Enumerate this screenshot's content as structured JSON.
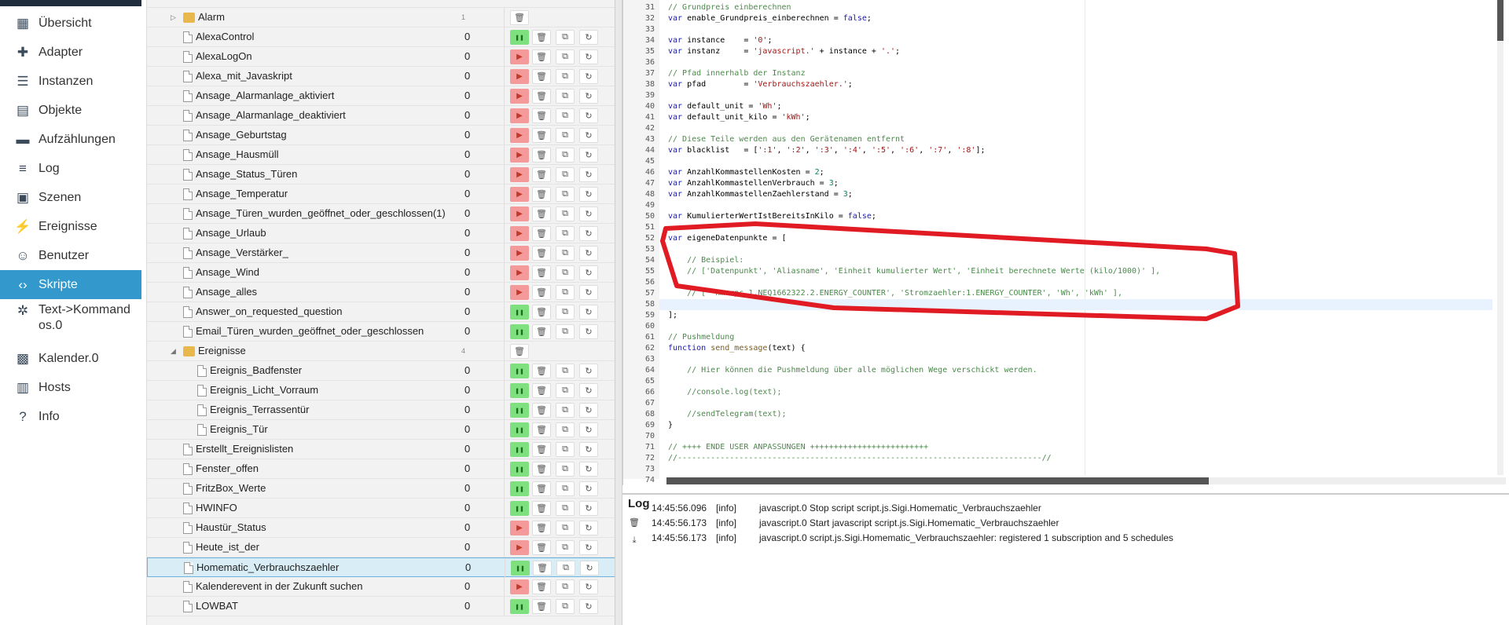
{
  "sidebar": {
    "items": [
      {
        "label": "Übersicht",
        "icon": "grid-icon"
      },
      {
        "label": "Adapter",
        "icon": "puzzle-icon"
      },
      {
        "label": "Instanzen",
        "icon": "list-icon"
      },
      {
        "label": "Objekte",
        "icon": "objects-icon"
      },
      {
        "label": "Aufzählungen",
        "icon": "enum-icon"
      },
      {
        "label": "Log",
        "icon": "log-icon"
      },
      {
        "label": "Szenen",
        "icon": "scenes-icon"
      },
      {
        "label": "Ereignisse",
        "icon": "lightning-icon"
      },
      {
        "label": "Benutzer",
        "icon": "user-icon"
      },
      {
        "label": "Skripte",
        "icon": "code-icon"
      },
      {
        "label": "Text->Kommandos.0",
        "icon": "asterisk-icon"
      },
      {
        "label": "Kalender.0",
        "icon": "calendar-icon"
      },
      {
        "label": "Hosts",
        "icon": "hosts-icon"
      },
      {
        "label": "Info",
        "icon": "info-icon"
      }
    ],
    "active": "Skripte"
  },
  "tree": {
    "folders": [
      {
        "name": "Alarm",
        "count": "1"
      },
      {
        "name": "Ereignisse",
        "count": "4"
      }
    ],
    "scripts": [
      {
        "name": "AlexaControl",
        "count": "0",
        "running": true
      },
      {
        "name": "AlexaLogOn",
        "count": "0",
        "running": false
      },
      {
        "name": "Alexa_mit_Javaskript",
        "count": "0",
        "running": false
      },
      {
        "name": "Ansage_Alarmanlage_aktiviert",
        "count": "0",
        "running": false
      },
      {
        "name": "Ansage_Alarmanlage_deaktiviert",
        "count": "0",
        "running": false
      },
      {
        "name": "Ansage_Geburtstag",
        "count": "0",
        "running": false
      },
      {
        "name": "Ansage_Hausmüll",
        "count": "0",
        "running": false
      },
      {
        "name": "Ansage_Status_Türen",
        "count": "0",
        "running": false
      },
      {
        "name": "Ansage_Temperatur",
        "count": "0",
        "running": false
      },
      {
        "name": "Ansage_Türen_wurden_geöffnet_oder_geschlossen(1)",
        "count": "0",
        "running": false
      },
      {
        "name": "Ansage_Urlaub",
        "count": "0",
        "running": false
      },
      {
        "name": "Ansage_Verstärker_",
        "count": "0",
        "running": false
      },
      {
        "name": "Ansage_Wind",
        "count": "0",
        "running": false
      },
      {
        "name": "Ansage_alles",
        "count": "0",
        "running": false
      },
      {
        "name": "Answer_on_requested_question",
        "count": "0",
        "running": true
      },
      {
        "name": "Email_Türen_wurden_geöffnet_oder_geschlossen",
        "count": "0",
        "running": true
      },
      {
        "name": "Ereignis_Badfenster",
        "count": "0",
        "running": true
      },
      {
        "name": "Ereignis_Licht_Vorraum",
        "count": "0",
        "running": true
      },
      {
        "name": "Ereignis_Terrassentür",
        "count": "0",
        "running": true
      },
      {
        "name": "Ereignis_Tür",
        "count": "0",
        "running": true
      },
      {
        "name": "Erstellt_Ereignislisten",
        "count": "0",
        "running": true
      },
      {
        "name": "Fenster_offen",
        "count": "0",
        "running": true
      },
      {
        "name": "FritzBox_Werte",
        "count": "0",
        "running": true
      },
      {
        "name": "HWINFO",
        "count": "0",
        "running": true
      },
      {
        "name": "Haustür_Status",
        "count": "0",
        "running": false
      },
      {
        "name": "Heute_ist_der",
        "count": "0",
        "running": false
      },
      {
        "name": "Homematic_Verbrauchszaehler",
        "count": "0",
        "running": true
      },
      {
        "name": "Kalenderevent in der Zukunft suchen",
        "count": "0",
        "running": false
      },
      {
        "name": "LOWBAT",
        "count": "0",
        "running": true
      }
    ]
  },
  "editor": {
    "lines": [
      {
        "n": "31",
        "text": "// Grundpreis einberechnen"
      },
      {
        "n": "32",
        "text": "var enable_Grundpreis_einberechnen = false;"
      },
      {
        "n": "33",
        "text": ""
      },
      {
        "n": "34",
        "text": "var instance    = '0';"
      },
      {
        "n": "35",
        "text": "var instanz     = 'javascript.' + instance + '.';"
      },
      {
        "n": "36",
        "text": ""
      },
      {
        "n": "37",
        "text": "// Pfad innerhalb der Instanz"
      },
      {
        "n": "38",
        "text": "var pfad        = 'Verbrauchszaehler.';"
      },
      {
        "n": "39",
        "text": ""
      },
      {
        "n": "40",
        "text": "var default_unit = 'Wh';"
      },
      {
        "n": "41",
        "text": "var default_unit_kilo = 'kWh';"
      },
      {
        "n": "42",
        "text": ""
      },
      {
        "n": "43",
        "text": "// Diese Teile werden aus den Gerätenamen entfernt"
      },
      {
        "n": "44",
        "text": "var blacklist   = [':1', ':2', ':3', ':4', ':5', ':6', ':7', ':8'];"
      },
      {
        "n": "45",
        "text": ""
      },
      {
        "n": "46",
        "text": "var AnzahlKommastellenKosten = 2;"
      },
      {
        "n": "47",
        "text": "var AnzahlKommastellenVerbrauch = 3;"
      },
      {
        "n": "48",
        "text": "var AnzahlKommastellenZaehlerstand = 3;"
      },
      {
        "n": "49",
        "text": ""
      },
      {
        "n": "50",
        "text": "var KumulierterWertIstBereitsInKilo = false;"
      },
      {
        "n": "51",
        "text": ""
      },
      {
        "n": "52",
        "text": "var eigeneDatenpunkte = ["
      },
      {
        "n": "53",
        "text": ""
      },
      {
        "n": "54",
        "text": "    // Beispiel:"
      },
      {
        "n": "55",
        "text": "    // ['Datenpunkt', 'Aliasname', 'Einheit kumulierter Wert', 'Einheit berechnete Werte (kilo/1000)' ],"
      },
      {
        "n": "56",
        "text": ""
      },
      {
        "n": "57",
        "text": "    // [ 'hm-rpc.1.NEQ1662322.2.ENERGY_COUNTER', 'Stromzaehler:1.ENERGY_COUNTER', 'Wh', 'kWh' ],"
      },
      {
        "n": "58",
        "text": "    "
      },
      {
        "n": "59",
        "text": "];"
      },
      {
        "n": "60",
        "text": ""
      },
      {
        "n": "61",
        "text": "// Pushmeldung"
      },
      {
        "n": "62",
        "text": "function send_message(text) {"
      },
      {
        "n": "63",
        "text": ""
      },
      {
        "n": "64",
        "text": "    // Hier können die Pushmeldung über alle möglichen Wege verschickt werden."
      },
      {
        "n": "65",
        "text": ""
      },
      {
        "n": "66",
        "text": "    //console.log(text);"
      },
      {
        "n": "67",
        "text": ""
      },
      {
        "n": "68",
        "text": "    //sendTelegram(text);"
      },
      {
        "n": "69",
        "text": "}"
      },
      {
        "n": "70",
        "text": ""
      },
      {
        "n": "71",
        "text": "// ++++ ENDE USER ANPASSUNGEN +++++++++++++++++++++++++"
      },
      {
        "n": "72",
        "text": "//-----------------------------------------------------------------------------//"
      },
      {
        "n": "73",
        "text": ""
      },
      {
        "n": "74",
        "text": ""
      }
    ]
  },
  "log": {
    "title": "Log",
    "entries": [
      {
        "time": "14:45:56.096",
        "level": "[info]",
        "msg": "javascript.0 Stop script script.js.Sigi.Homematic_Verbrauchszaehler"
      },
      {
        "time": "14:45:56.173",
        "level": "[info]",
        "msg": "javascript.0 Start javascript script.js.Sigi.Homematic_Verbrauchszaehler"
      },
      {
        "time": "14:45:56.173",
        "level": "[info]",
        "msg": "javascript.0 script.js.Sigi.Homematic_Verbrauchszaehler: registered 1 subscription and 5 schedules"
      }
    ]
  },
  "colors": {
    "accent": "#3399cc",
    "run": "#7fe07f",
    "stop": "#f49a9a",
    "highlight": "#e01b24"
  }
}
